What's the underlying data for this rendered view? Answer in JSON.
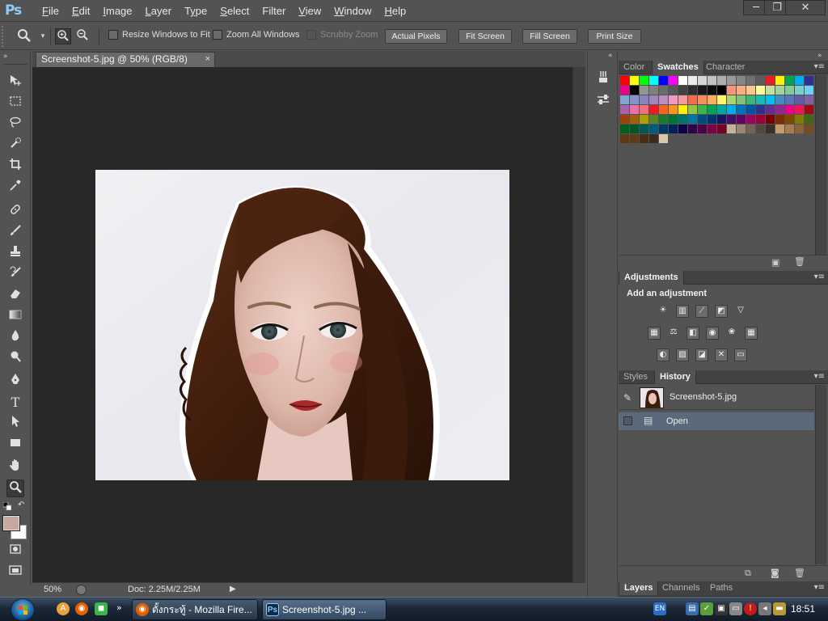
{
  "app": {
    "logo": "Ps",
    "menus": [
      "File",
      "Edit",
      "Image",
      "Layer",
      "Type",
      "Select",
      "Filter",
      "View",
      "Window",
      "Help"
    ],
    "menu_mnemonics": [
      "F",
      "E",
      "I",
      "L",
      "y",
      "S",
      "T",
      "V",
      "W",
      "H"
    ],
    "window_controls": {
      "minimize": "─",
      "restore": "❐",
      "close": "✕"
    }
  },
  "options_bar": {
    "tool_icon": "zoom-icon",
    "zoom_in_icon": "zoom-in-icon",
    "zoom_out_icon": "zoom-out-icon",
    "resize_windows": "Resize Windows to Fit",
    "zoom_all_windows": "Zoom All Windows",
    "scrubby_zoom": "Scrubby Zoom",
    "buttons": [
      "Actual Pixels",
      "Fit Screen",
      "Fill Screen",
      "Print Size"
    ]
  },
  "document": {
    "tab_title": "Screenshot-5.jpg @ 50% (RGB/8)",
    "close_glyph": "×"
  },
  "status_bar": {
    "zoom": "50%",
    "doc_info": "Doc: 2.25M/2.25M"
  },
  "panels": {
    "swatch_group": {
      "tabs": [
        "Color",
        "Swatches",
        "Character"
      ],
      "active": "Swatches"
    },
    "adjustments": {
      "tab": "Adjustments",
      "heading": "Add an adjustment"
    },
    "history_group": {
      "tabs": [
        "Styles",
        "History"
      ],
      "active": "History"
    },
    "history": {
      "snapshot_label": "Screenshot-5.jpg",
      "steps": [
        "Open"
      ]
    },
    "layers_group": {
      "tabs": [
        "Layers",
        "Channels",
        "Paths"
      ],
      "active": "Layers"
    }
  },
  "swatches": [
    "#ff0000",
    "#ffff00",
    "#00ff00",
    "#00ffff",
    "#0000ff",
    "#ff00ff",
    "#ffffff",
    "#ebebeb",
    "#d6d6d6",
    "#c2c2c2",
    "#adadad",
    "#999999",
    "#858585",
    "#707070",
    "#5c5c5c",
    "#ed1c24",
    "#fff200",
    "#00a651",
    "#00aeef",
    "#2e3192",
    "#ec008c",
    "#000000",
    "#949494",
    "#808080",
    "#6b6b6b",
    "#575757",
    "#424242",
    "#2e2e2e",
    "#1a1a1a",
    "#0d0d0d",
    "#000000",
    "#f7977a",
    "#f9ad81",
    "#fdc68a",
    "#fff79a",
    "#c4df9b",
    "#a3d39c",
    "#82ca9d",
    "#7bcdc8",
    "#6ecff6",
    "#7ea7d8",
    "#8493ca",
    "#8882be",
    "#a187be",
    "#bc8dbf",
    "#f49ac2",
    "#f6989d",
    "#f26c4f",
    "#f68e56",
    "#fbaf5d",
    "#fff568",
    "#acd372",
    "#7cc576",
    "#3bb878",
    "#1abbb4",
    "#00bff3",
    "#438cca",
    "#5574b9",
    "#605ca8",
    "#855fa8",
    "#a863a8",
    "#f06eaa",
    "#f26d7d",
    "#ed1c24",
    "#f26522",
    "#f7941d",
    "#fff200",
    "#8dc63f",
    "#39b54a",
    "#00a651",
    "#00a99d",
    "#00aeef",
    "#0072bc",
    "#0054a6",
    "#2e3192",
    "#662d91",
    "#92278f",
    "#ec008c",
    "#ed145b",
    "#9e0b0f",
    "#a0410d",
    "#a36209",
    "#aba000",
    "#598527",
    "#1a7b30",
    "#007236",
    "#00746b",
    "#0076a3",
    "#004b80",
    "#003471",
    "#1b1464",
    "#440e62",
    "#630460",
    "#9e005d",
    "#9e0039",
    "#790000",
    "#7b2e00",
    "#7d4900",
    "#827b00",
    "#406618",
    "#005e20",
    "#005826",
    "#005952",
    "#005b7f",
    "#003663",
    "#002157",
    "#0d004c",
    "#32004b",
    "#4b0049",
    "#7b0046",
    "#7a0026",
    "#c7b299",
    "#998675",
    "#736357",
    "#534741",
    "#37302d",
    "#c69c6d",
    "#a67c52",
    "#8c6239",
    "#754c24",
    "#603913",
    "#5c3b1a",
    "#482d12",
    "#3a2b1c",
    "#d9c9a8"
  ],
  "taskbar": {
    "tasks": [
      {
        "label": "ตั้งกระทู้ - Mozilla Fire...",
        "icon": "firefox-icon"
      },
      {
        "label": "Screenshot-5.jpg ...",
        "icon": "photoshop-icon"
      }
    ],
    "language": "EN",
    "clock": "18:51"
  },
  "colors": {
    "foreground_swatch": "#c9a7a0",
    "background_swatch": "#ffffff",
    "accent": "#8ecbf5",
    "history_selected": "#5a6a7b"
  }
}
